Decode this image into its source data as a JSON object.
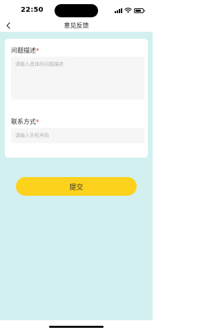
{
  "status_bar": {
    "time": "22:50",
    "battery_level": 0.8
  },
  "nav": {
    "title": "意见反馈",
    "back_icon": "chevron-left-icon"
  },
  "form": {
    "description_label": "问题描述",
    "description_placeholder": "请输入具体的问题描述",
    "description_value": "",
    "contact_label": "联系方式",
    "contact_placeholder": "请输入手机号码",
    "contact_value": "",
    "required_mark": "*"
  },
  "actions": {
    "submit_label": "提交"
  },
  "colors": {
    "background": "#d3f0f0",
    "card": "#ffffff",
    "input_fill": "#f6f6f6",
    "required": "#e0321e",
    "submit": "#fcd21c"
  }
}
